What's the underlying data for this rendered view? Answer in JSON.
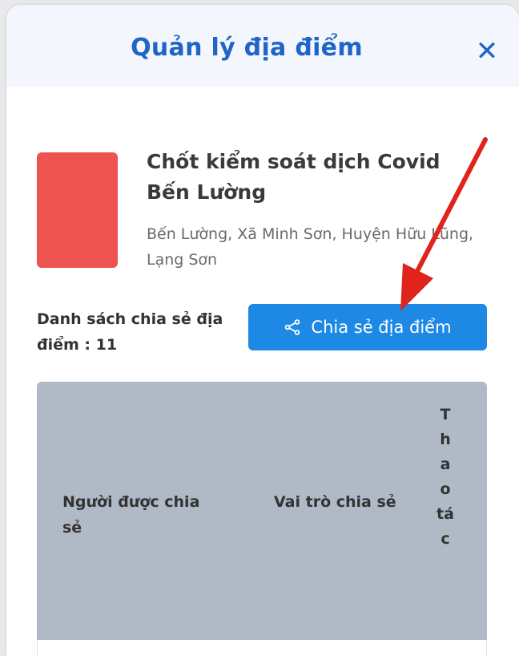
{
  "modal": {
    "title": "Quản lý địa điểm",
    "close_icon": "close-icon"
  },
  "place": {
    "name": "Chốt kiểm soát dịch Covid Bến Lường",
    "address": "Bến Lường, Xã Minh Sơn, Huyện Hữu Lũng, Lạng Sơn",
    "thumbnail_color": "#ef5350"
  },
  "share": {
    "list_label": "Danh sách chia sẻ địa điểm : 11",
    "button_label": "Chia sẻ địa điểm",
    "button_icon": "share-icon"
  },
  "table": {
    "columns": [
      "Người được chia sẻ",
      "Vai trò chia sẻ",
      "Thao tác"
    ]
  },
  "colors": {
    "accent": "#1f64c7",
    "button": "#1e88e5",
    "header_bg": "#f3f6fc",
    "table_header_bg": "#b0bac7",
    "annotation_arrow": "#e0241b"
  }
}
